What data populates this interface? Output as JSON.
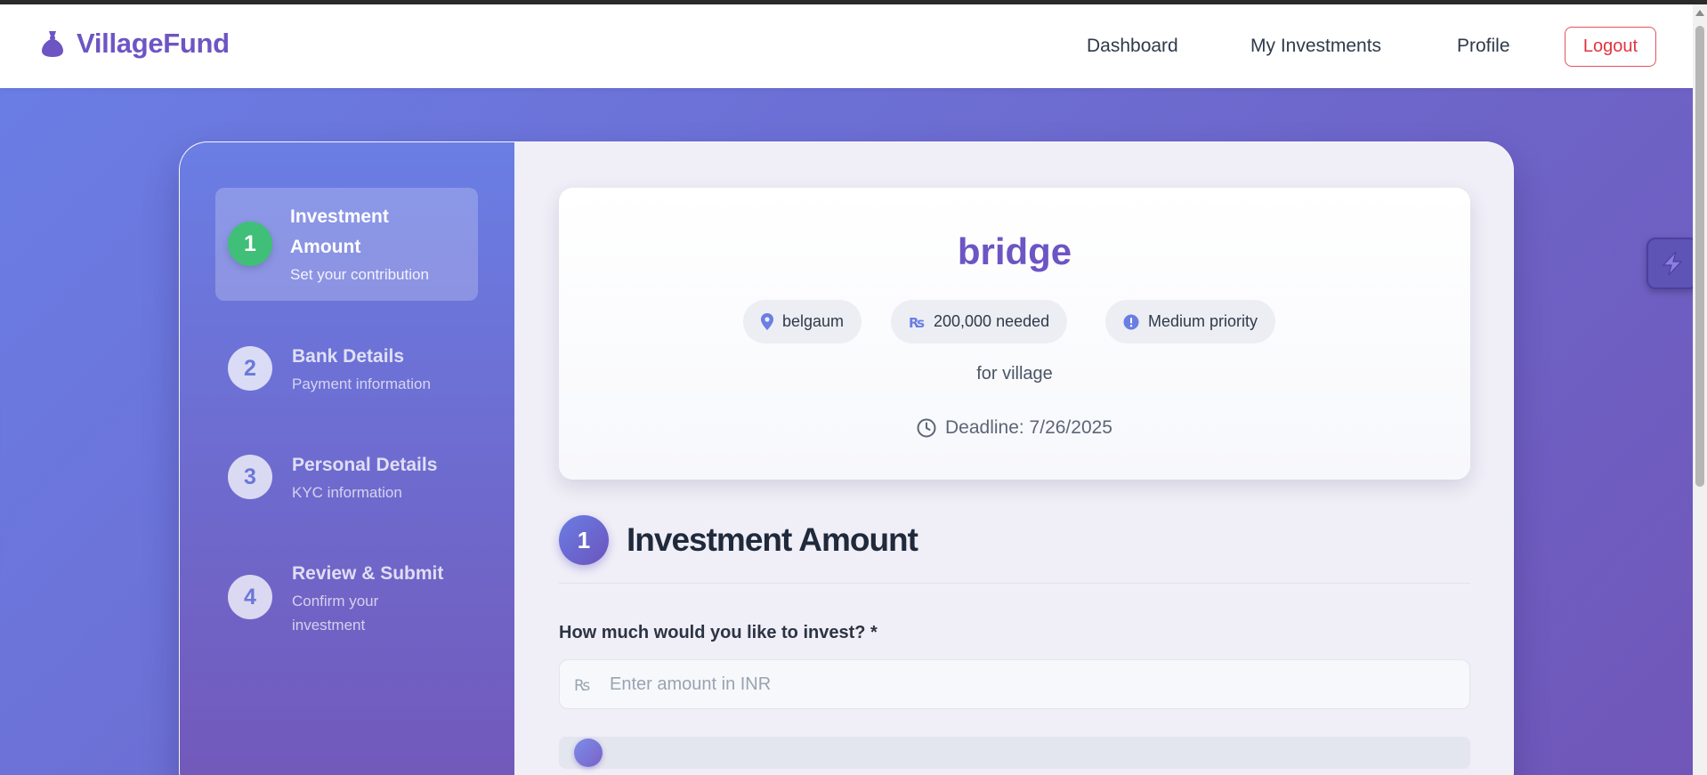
{
  "brand": {
    "name": "VillageFund",
    "icon": "money-bag-icon",
    "color": "#6d55c4"
  },
  "nav": {
    "links": [
      "Dashboard",
      "My Investments",
      "Profile"
    ],
    "logout": "Logout"
  },
  "steps": [
    {
      "number": "1",
      "title": "Investment Amount",
      "subtitle": "Set your contribution",
      "active": true
    },
    {
      "number": "2",
      "title": "Bank Details",
      "subtitle": "Payment information",
      "active": false
    },
    {
      "number": "3",
      "title": "Personal Details",
      "subtitle": "KYC information",
      "active": false
    },
    {
      "number": "4",
      "title": "Review & Submit",
      "subtitle": "Confirm your investment",
      "active": false
    }
  ],
  "project": {
    "title": "bridge",
    "location": "belgaum",
    "needed": "200,000 needed",
    "priority": "Medium priority",
    "description": "for village",
    "deadline": "Deadline: 7/26/2025"
  },
  "section": {
    "number": "1",
    "title": "Investment Amount"
  },
  "amount_field": {
    "label": "How much would you like to invest? *",
    "placeholder": "Enter amount in INR",
    "value": "",
    "currency_icon": "rupee-icon"
  },
  "slider": {
    "value": 0
  },
  "colors": {
    "accent": "#6d55c4",
    "gradient_start": "#6a7fe6",
    "gradient_end": "#7056b8",
    "active_step": "#3fbf78",
    "logout": "#e0353f"
  }
}
